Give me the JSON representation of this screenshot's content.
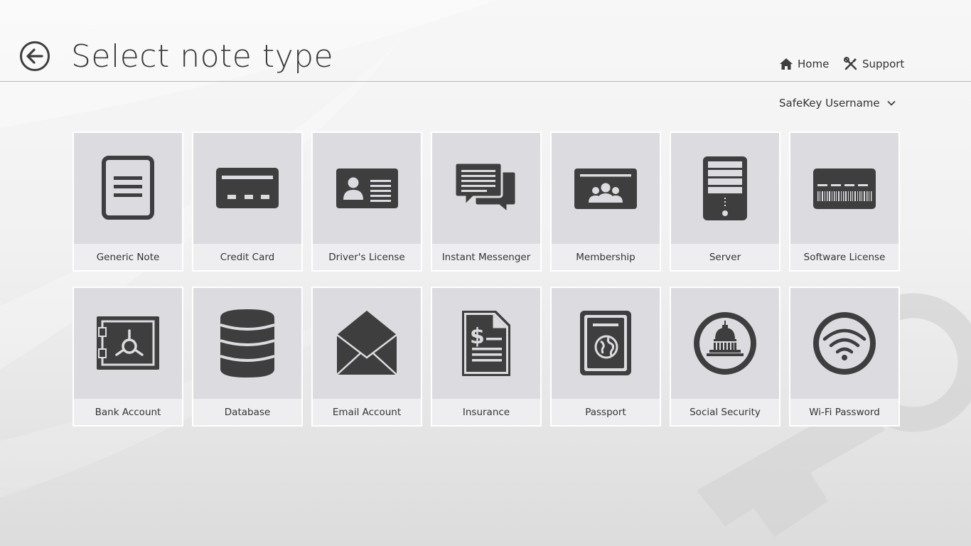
{
  "header": {
    "title": "Select note type",
    "nav": {
      "home_label": "Home",
      "support_label": "Support"
    }
  },
  "user": {
    "name": "SafeKey Username"
  },
  "tiles": [
    {
      "label": "Generic Note",
      "icon": "document-icon"
    },
    {
      "label": "Credit Card",
      "icon": "credit-card-icon"
    },
    {
      "label": "Driver's License",
      "icon": "id-card-icon"
    },
    {
      "label": "Instant Messenger",
      "icon": "chat-bubbles-icon"
    },
    {
      "label": "Membership",
      "icon": "group-card-icon"
    },
    {
      "label": "Server",
      "icon": "server-icon"
    },
    {
      "label": "Software License",
      "icon": "barcode-card-icon"
    },
    {
      "label": "Bank Account",
      "icon": "safe-icon"
    },
    {
      "label": "Database",
      "icon": "database-icon"
    },
    {
      "label": "Email Account",
      "icon": "envelope-icon"
    },
    {
      "label": "Insurance",
      "icon": "dollar-document-icon"
    },
    {
      "label": "Passport",
      "icon": "passport-icon"
    },
    {
      "label": "Social Security",
      "icon": "capitol-icon"
    },
    {
      "label": "Wi-Fi Password",
      "icon": "wifi-icon"
    }
  ],
  "colors": {
    "icon": "#3e3e3e",
    "tile_icon_bg": "#dcdbe0",
    "tile_label_bg": "#eeeef1",
    "title_text": "#3a3a3a"
  }
}
